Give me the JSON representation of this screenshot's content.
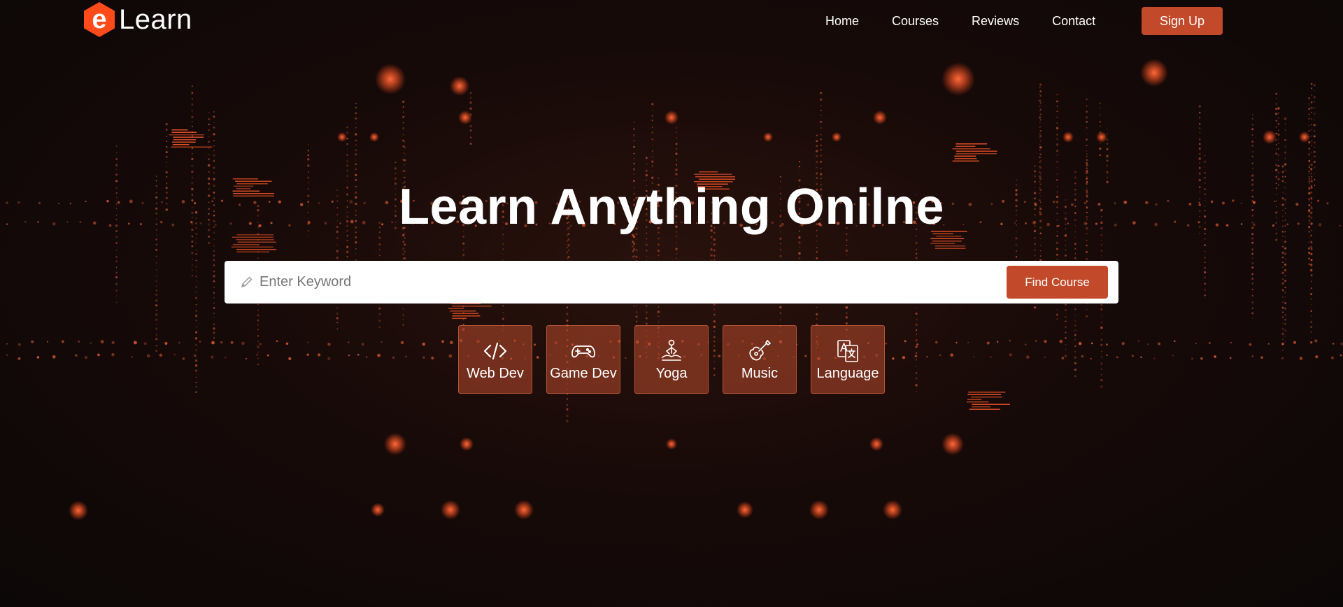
{
  "brand": {
    "name": "Learn",
    "logo_letter": "e",
    "accent_color": "#ff4a1a"
  },
  "nav": {
    "items": [
      {
        "label": "Home"
      },
      {
        "label": "Courses"
      },
      {
        "label": "Reviews"
      },
      {
        "label": "Contact"
      }
    ],
    "signup_label": "Sign Up"
  },
  "hero": {
    "title": "Learn Anything Onilne"
  },
  "search": {
    "placeholder": "Enter Keyword",
    "value": "",
    "button_label": "Find Course",
    "icon": "pencil-icon"
  },
  "categories": [
    {
      "label": "Web Dev",
      "icon": "code-icon"
    },
    {
      "label": "Game Dev",
      "icon": "gamepad-icon"
    },
    {
      "label": "Yoga",
      "icon": "meditation-icon"
    },
    {
      "label": "Music",
      "icon": "guitar-icon"
    },
    {
      "label": "Language",
      "icon": "translate-icon"
    }
  ],
  "colors": {
    "button": "#c24a2a",
    "category_tile": "#b94b2d",
    "background": "#170a08"
  }
}
